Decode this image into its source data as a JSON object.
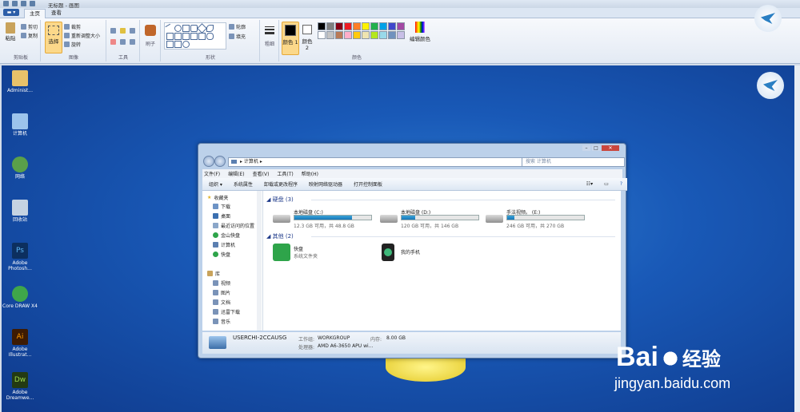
{
  "window": {
    "title": "无标题 - 画图"
  },
  "tabs": {
    "file": "▬ ▾",
    "home": "主页",
    "view": "查看"
  },
  "ribbon": {
    "clipboard": {
      "paste": "粘贴",
      "cut": "剪切",
      "copy": "复制",
      "label": "剪贴板"
    },
    "image": {
      "select": "选择",
      "crop": "裁剪",
      "resize": "重新调整大小",
      "rotate": "旋转",
      "label": "图像"
    },
    "tools": {
      "label": "工具"
    },
    "brushes": {
      "label": "刷子"
    },
    "shapes": {
      "outline": "轮廓",
      "fill": "填充",
      "label": "形状"
    },
    "size": {
      "label": "粗细"
    },
    "colors": {
      "color1": "颜色 1",
      "color2": "颜色 2",
      "edit": "编辑颜色",
      "label": "颜色",
      "palette": [
        "#000000",
        "#7f7f7f",
        "#880015",
        "#ed1c24",
        "#ff7f27",
        "#fff200",
        "#22b14c",
        "#00a2e8",
        "#3f48cc",
        "#a349a4",
        "#ffffff",
        "#c3c3c3",
        "#b97a57",
        "#ffaec9",
        "#ffc90e",
        "#efe4b0",
        "#b5e61d",
        "#99d9ea",
        "#7092be",
        "#c8bfe7"
      ]
    }
  },
  "desktop": {
    "icons": [
      "Administ...",
      "计算机",
      "网络",
      "回收站",
      "Adobe Photosh...",
      "Core DRAW X4",
      "Adobe Illustrat...",
      "Adobe Dreamwe..."
    ]
  },
  "explorer": {
    "address": "计算机",
    "search_placeholder": "搜索 计算机",
    "menu": [
      "文件(F)",
      "编辑(E)",
      "查看(V)",
      "工具(T)",
      "帮助(H)"
    ],
    "commands": [
      "组织 ▾",
      "系统属性",
      "卸载或更改程序",
      "映射网络驱动器",
      "打开控制面板"
    ],
    "nav": {
      "favorites": "收藏夹",
      "fav_items": [
        "下载",
        "桌面",
        "最近访问的位置",
        "金山快盘",
        "计算机",
        "快盘"
      ],
      "library": "库",
      "lib_items": [
        "视频",
        "图片",
        "文档",
        "迅雷下载",
        "音乐"
      ]
    },
    "hard_disks_header": "硬盘 (3)",
    "drives": [
      {
        "name": "本地磁盘 (C:)",
        "free": "12.3 GB 可用，共 48.8 GB",
        "used_fraction": 0.75
      },
      {
        "name": "本地磁盘 (D:)",
        "free": "120 GB 可用，共 146 GB",
        "used_fraction": 0.18
      },
      {
        "name": "手法视频。 (E:)",
        "free": "246 GB 可用，共 270 GB",
        "used_fraction": 0.09
      }
    ],
    "other_header": "其他 (2)",
    "other_items": [
      {
        "name": "快盘",
        "sub": "系统文件夹"
      },
      {
        "name": "我的手机",
        "sub": ""
      }
    ],
    "details": {
      "computer_name": "USERCHI-2CCAUSG",
      "workgroup_label": "工作组:",
      "workgroup": "WORKGROUP",
      "memory_label": "内存:",
      "memory": "8.00 GB",
      "processor_label": "处理器:",
      "processor": "AMD A6-3650 APU wi..."
    }
  },
  "watermark": {
    "brand": "Bai",
    "brand2": "经验",
    "url": "jingyan.baidu.com"
  }
}
